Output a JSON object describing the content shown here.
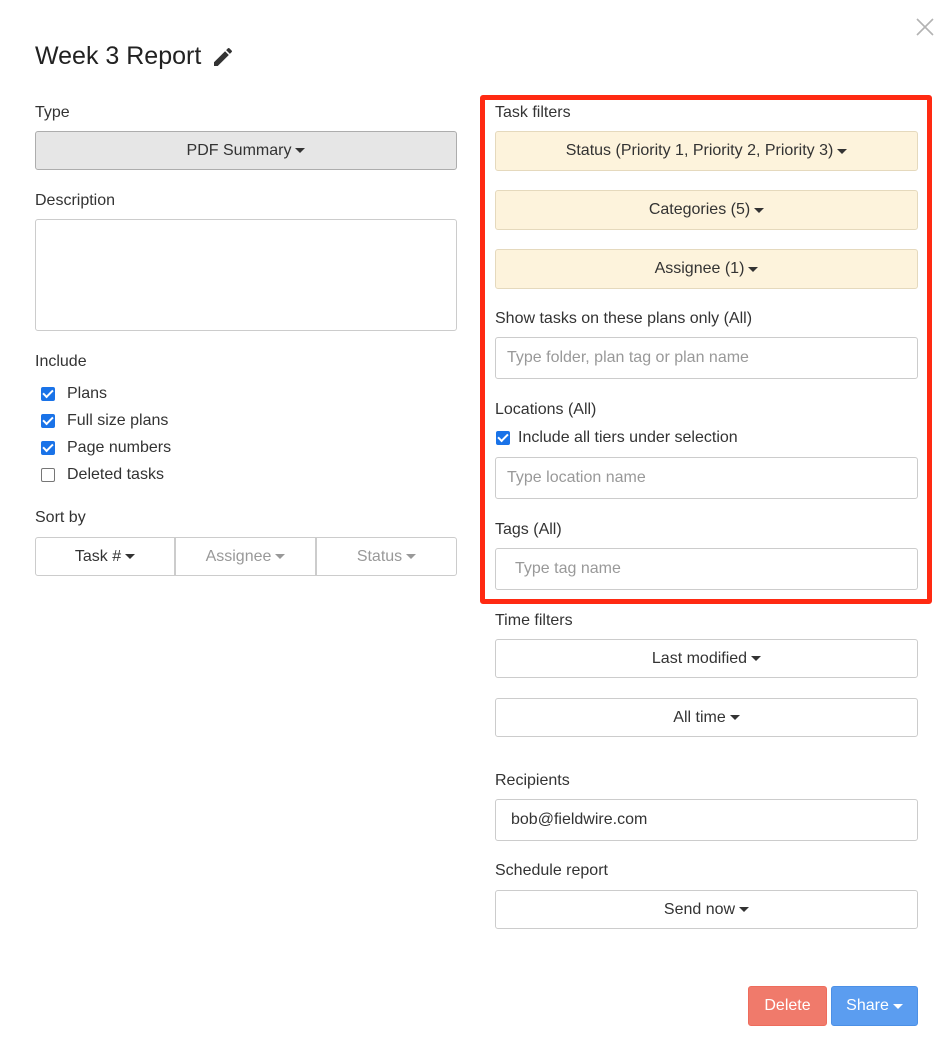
{
  "dialog": {
    "title": "Week 3 Report",
    "edit_icon": "pencil-icon",
    "close_icon": "close-icon"
  },
  "left": {
    "type_label": "Type",
    "type_value": "PDF Summary",
    "description_label": "Description",
    "description_value": "",
    "include_label": "Include",
    "include_items": [
      {
        "label": "Plans",
        "checked": true
      },
      {
        "label": "Full size plans",
        "checked": true
      },
      {
        "label": "Page numbers",
        "checked": true
      },
      {
        "label": "Deleted tasks",
        "checked": false
      }
    ],
    "sort_label": "Sort by",
    "sort_options": [
      {
        "label": "Task #",
        "active": true
      },
      {
        "label": "Assignee",
        "active": false
      },
      {
        "label": "Status",
        "active": false
      }
    ]
  },
  "task_filters": {
    "label": "Task filters",
    "status_button": "Status (Priority 1, Priority 2, Priority 3)",
    "categories_button": "Categories (5)",
    "assignee_button": "Assignee (1)",
    "plans_label": "Show tasks on these plans only (All)",
    "plans_placeholder": "Type folder, plan tag or plan name",
    "locations_label": "Locations (All)",
    "include_tiers_label": "Include all tiers under selection",
    "include_tiers_checked": true,
    "location_placeholder": "Type location name",
    "tags_label": "Tags (All)",
    "tags_placeholder": "Type tag name"
  },
  "time_filters": {
    "label": "Time filters",
    "field_button": "Last modified",
    "range_button": "All time"
  },
  "recipients": {
    "label": "Recipients",
    "value": "bob@fieldwire.com"
  },
  "schedule": {
    "label": "Schedule report",
    "button": "Send now"
  },
  "footer": {
    "delete_label": "Delete",
    "share_label": "Share"
  },
  "colors": {
    "highlight": "#ff2a12",
    "filter_button_bg": "#fdf3dc",
    "delete_bg": "#f07a6b",
    "share_bg": "#5b9df0",
    "checkbox": "#1a73e8"
  }
}
